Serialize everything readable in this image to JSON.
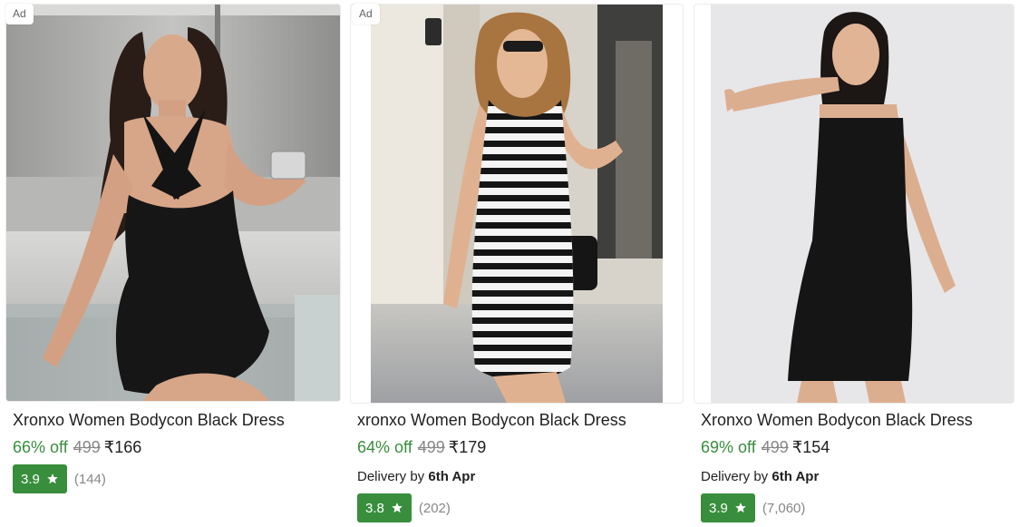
{
  "products": [
    {
      "ad_label": "Ad",
      "title": "Xronxo Women Bodycon Black Dress",
      "discount": "66% off",
      "mrp": "499",
      "price": "₹166",
      "rating": "3.9",
      "reviews": "(144)"
    },
    {
      "ad_label": "Ad",
      "title": "xronxo Women Bodycon Black Dress",
      "discount": "64% off",
      "mrp": "499",
      "price": "₹179",
      "delivery_prefix": "Delivery by",
      "delivery_date": "6th Apr",
      "rating": "3.8",
      "reviews": "(202)"
    },
    {
      "title": "Xronxo Women Bodycon Black Dress",
      "discount": "69% off",
      "mrp": "499",
      "price": "₹154",
      "delivery_prefix": "Delivery by",
      "delivery_date": "6th Apr",
      "rating": "3.9",
      "reviews": "(7,060)"
    }
  ],
  "colors": {
    "discount_green": "#388e3c",
    "rating_badge_green": "#388e3c",
    "mrp_grey": "#878787"
  },
  "icons": [
    "star-icon"
  ]
}
